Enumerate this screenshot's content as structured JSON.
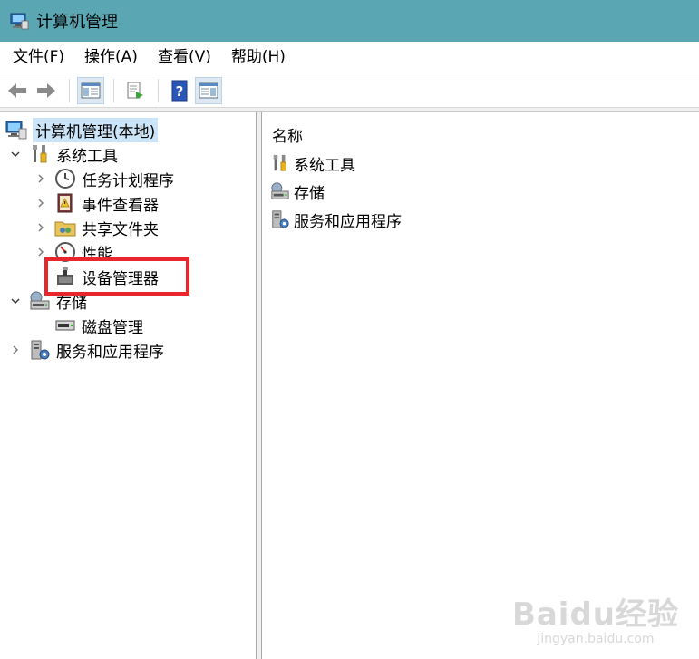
{
  "window": {
    "title": "计算机管理"
  },
  "menu": {
    "items": [
      "文件(F)",
      "操作(A)",
      "查看(V)",
      "帮助(H)"
    ]
  },
  "toolbar": {
    "buttons": [
      "back-arrow-icon",
      "forward-arrow-icon",
      "show-tree-icon",
      "export-list-icon",
      "help-icon",
      "show-action-pane-icon"
    ]
  },
  "tree": {
    "root": "计算机管理(本地)",
    "system_tools": "系统工具",
    "task_scheduler": "任务计划程序",
    "event_viewer": "事件查看器",
    "shared_folders": "共享文件夹",
    "performance": "性能",
    "device_manager": "设备管理器",
    "storage": "存储",
    "disk_management": "磁盘管理",
    "services_apps": "服务和应用程序"
  },
  "list": {
    "column_name": "名称",
    "items": [
      "系统工具",
      "存储",
      "服务和应用程序"
    ]
  },
  "watermark": {
    "main": "Baidu经验",
    "sub": "jingyan.baidu.com"
  },
  "colors": {
    "titlebar": "#5aa7b3",
    "selection": "#cce4f7",
    "highlight_box": "#e8262b"
  }
}
